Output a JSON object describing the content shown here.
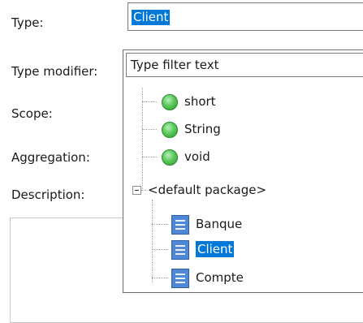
{
  "form": {
    "type_label": "Type:",
    "type_value": "Client",
    "type_modifier_label": "Type modifier:",
    "scope_label": "Scope:",
    "aggregation_label": "Aggregation:",
    "description_label": "Description:"
  },
  "popup": {
    "filter_placeholder": "Type filter text",
    "primitives": [
      {
        "label": "short",
        "icon": "green-circle-icon"
      },
      {
        "label": "String",
        "icon": "green-circle-icon"
      },
      {
        "label": "void",
        "icon": "green-circle-icon"
      }
    ],
    "package": {
      "label": "<default package>",
      "expanded": true,
      "classes": [
        {
          "label": "Banque",
          "icon": "class-icon",
          "selected": false
        },
        {
          "label": "Client",
          "icon": "class-icon",
          "selected": true
        },
        {
          "label": "Compte",
          "icon": "class-icon",
          "selected": false
        }
      ]
    }
  },
  "colors": {
    "selection": "#0078d7",
    "primitive_icon": "#5cc95c",
    "class_icon": "#4f88d6"
  }
}
